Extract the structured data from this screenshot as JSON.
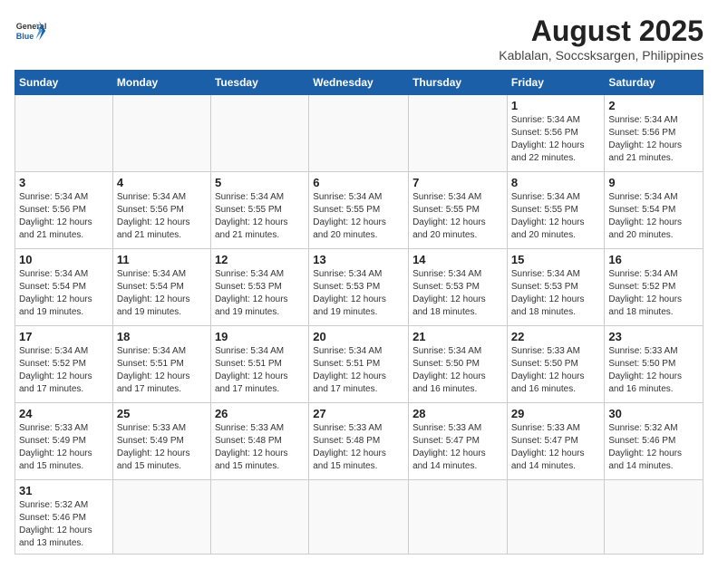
{
  "header": {
    "logo_general": "General",
    "logo_blue": "Blue",
    "month_title": "August 2025",
    "location": "Kablalan, Soccsksargen, Philippines"
  },
  "weekdays": [
    "Sunday",
    "Monday",
    "Tuesday",
    "Wednesday",
    "Thursday",
    "Friday",
    "Saturday"
  ],
  "weeks": [
    [
      {
        "day": "",
        "info": ""
      },
      {
        "day": "",
        "info": ""
      },
      {
        "day": "",
        "info": ""
      },
      {
        "day": "",
        "info": ""
      },
      {
        "day": "",
        "info": ""
      },
      {
        "day": "1",
        "info": "Sunrise: 5:34 AM\nSunset: 5:56 PM\nDaylight: 12 hours\nand 22 minutes."
      },
      {
        "day": "2",
        "info": "Sunrise: 5:34 AM\nSunset: 5:56 PM\nDaylight: 12 hours\nand 21 minutes."
      }
    ],
    [
      {
        "day": "3",
        "info": "Sunrise: 5:34 AM\nSunset: 5:56 PM\nDaylight: 12 hours\nand 21 minutes."
      },
      {
        "day": "4",
        "info": "Sunrise: 5:34 AM\nSunset: 5:56 PM\nDaylight: 12 hours\nand 21 minutes."
      },
      {
        "day": "5",
        "info": "Sunrise: 5:34 AM\nSunset: 5:55 PM\nDaylight: 12 hours\nand 21 minutes."
      },
      {
        "day": "6",
        "info": "Sunrise: 5:34 AM\nSunset: 5:55 PM\nDaylight: 12 hours\nand 20 minutes."
      },
      {
        "day": "7",
        "info": "Sunrise: 5:34 AM\nSunset: 5:55 PM\nDaylight: 12 hours\nand 20 minutes."
      },
      {
        "day": "8",
        "info": "Sunrise: 5:34 AM\nSunset: 5:55 PM\nDaylight: 12 hours\nand 20 minutes."
      },
      {
        "day": "9",
        "info": "Sunrise: 5:34 AM\nSunset: 5:54 PM\nDaylight: 12 hours\nand 20 minutes."
      }
    ],
    [
      {
        "day": "10",
        "info": "Sunrise: 5:34 AM\nSunset: 5:54 PM\nDaylight: 12 hours\nand 19 minutes."
      },
      {
        "day": "11",
        "info": "Sunrise: 5:34 AM\nSunset: 5:54 PM\nDaylight: 12 hours\nand 19 minutes."
      },
      {
        "day": "12",
        "info": "Sunrise: 5:34 AM\nSunset: 5:53 PM\nDaylight: 12 hours\nand 19 minutes."
      },
      {
        "day": "13",
        "info": "Sunrise: 5:34 AM\nSunset: 5:53 PM\nDaylight: 12 hours\nand 19 minutes."
      },
      {
        "day": "14",
        "info": "Sunrise: 5:34 AM\nSunset: 5:53 PM\nDaylight: 12 hours\nand 18 minutes."
      },
      {
        "day": "15",
        "info": "Sunrise: 5:34 AM\nSunset: 5:53 PM\nDaylight: 12 hours\nand 18 minutes."
      },
      {
        "day": "16",
        "info": "Sunrise: 5:34 AM\nSunset: 5:52 PM\nDaylight: 12 hours\nand 18 minutes."
      }
    ],
    [
      {
        "day": "17",
        "info": "Sunrise: 5:34 AM\nSunset: 5:52 PM\nDaylight: 12 hours\nand 17 minutes."
      },
      {
        "day": "18",
        "info": "Sunrise: 5:34 AM\nSunset: 5:51 PM\nDaylight: 12 hours\nand 17 minutes."
      },
      {
        "day": "19",
        "info": "Sunrise: 5:34 AM\nSunset: 5:51 PM\nDaylight: 12 hours\nand 17 minutes."
      },
      {
        "day": "20",
        "info": "Sunrise: 5:34 AM\nSunset: 5:51 PM\nDaylight: 12 hours\nand 17 minutes."
      },
      {
        "day": "21",
        "info": "Sunrise: 5:34 AM\nSunset: 5:50 PM\nDaylight: 12 hours\nand 16 minutes."
      },
      {
        "day": "22",
        "info": "Sunrise: 5:33 AM\nSunset: 5:50 PM\nDaylight: 12 hours\nand 16 minutes."
      },
      {
        "day": "23",
        "info": "Sunrise: 5:33 AM\nSunset: 5:50 PM\nDaylight: 12 hours\nand 16 minutes."
      }
    ],
    [
      {
        "day": "24",
        "info": "Sunrise: 5:33 AM\nSunset: 5:49 PM\nDaylight: 12 hours\nand 15 minutes."
      },
      {
        "day": "25",
        "info": "Sunrise: 5:33 AM\nSunset: 5:49 PM\nDaylight: 12 hours\nand 15 minutes."
      },
      {
        "day": "26",
        "info": "Sunrise: 5:33 AM\nSunset: 5:48 PM\nDaylight: 12 hours\nand 15 minutes."
      },
      {
        "day": "27",
        "info": "Sunrise: 5:33 AM\nSunset: 5:48 PM\nDaylight: 12 hours\nand 15 minutes."
      },
      {
        "day": "28",
        "info": "Sunrise: 5:33 AM\nSunset: 5:47 PM\nDaylight: 12 hours\nand 14 minutes."
      },
      {
        "day": "29",
        "info": "Sunrise: 5:33 AM\nSunset: 5:47 PM\nDaylight: 12 hours\nand 14 minutes."
      },
      {
        "day": "30",
        "info": "Sunrise: 5:32 AM\nSunset: 5:46 PM\nDaylight: 12 hours\nand 14 minutes."
      }
    ],
    [
      {
        "day": "31",
        "info": "Sunrise: 5:32 AM\nSunset: 5:46 PM\nDaylight: 12 hours\nand 13 minutes."
      },
      {
        "day": "",
        "info": ""
      },
      {
        "day": "",
        "info": ""
      },
      {
        "day": "",
        "info": ""
      },
      {
        "day": "",
        "info": ""
      },
      {
        "day": "",
        "info": ""
      },
      {
        "day": "",
        "info": ""
      }
    ]
  ]
}
